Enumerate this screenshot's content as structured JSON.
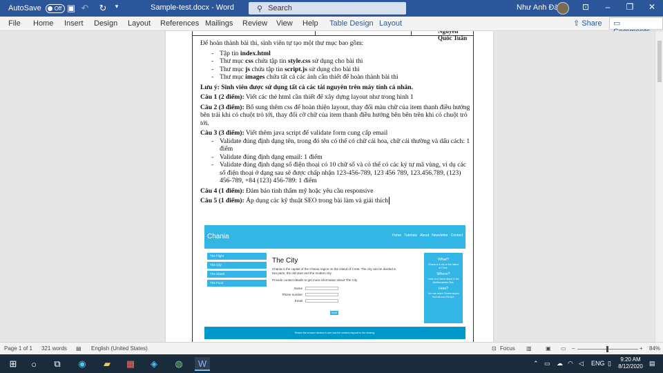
{
  "titlebar": {
    "autosave_label": "AutoSave",
    "autosave_state": "Off",
    "filename": "Sample-test.docx  -  Word",
    "search_placeholder": "Search",
    "user_name": "Như Anh Đào"
  },
  "ribbon": {
    "tabs": [
      "File",
      "Home",
      "Insert",
      "Design",
      "Layout",
      "References",
      "Mailings",
      "Review",
      "View",
      "Help",
      "Table Design",
      "Layout"
    ],
    "share_label": "Share",
    "comments_label": "Comments"
  },
  "document": {
    "header_name": "Nguyễn Quốc Tuấn",
    "intro": "Để hoàn thành bài thi, sinh viên tự tạo một thư mục bao gồm:",
    "files": [
      {
        "pre": "Tập tin ",
        "bold": "index.html",
        "post": ""
      },
      {
        "pre": "Thư mục ",
        "bold": "css",
        "post": " chứa tập tin ",
        "bold2": "style.css",
        "post2": " sử dụng cho bài thi"
      },
      {
        "pre": "Thư mục ",
        "bold": "js",
        "post": " chứa tập tin ",
        "bold2": "script.js",
        "post2": " sử dụng cho bài thi"
      },
      {
        "pre": "Thư mục ",
        "bold": "images",
        "post": " chứa tất cả các ảnh cần thiết để hoàn thành bài thi"
      }
    ],
    "note_label": "Lưu ý:",
    "note_text": " Sinh viên được sử dụng tất cả các tài nguyên trên máy tính cá nhân.",
    "q1_label": "Câu 1 (2 điểm):",
    "q1_text": " Viết các thẻ html cần thiết để xây dựng layout như trong hình 1",
    "q2_label": "Câu 2 (3 điểm):",
    "q2_text": " Bổ sung thêm css để hoàn thiện layout, thay đổi màu chữ của item thanh điều hướng bên trái khi có chuột trỏ tới, thay đổi cỡ chữ của item thanh điều hướng bên bên trên khi có chuột trỏ tới.",
    "q3_label": "Câu 3 (3 điểm):",
    "q3_text": " Viết thêm java script để validate form cung cấp email",
    "q3_items": [
      "Validate đúng định dạng tên, trong đó tên có thể có chữ cái hoa, chữ cái thường và dấu cách: 1 điểm",
      "Validate đúng định dạng email: 1 điểm",
      "Validate đúng định dạng số điện thoại có 10 chữ số và có thể có các ký tự mã vùng, ví dụ các số điện thoại ở dạng sau sẽ được chấp nhận 123-456-789, 123 456 789, 123.456.789, (123) 456-789, +84 (123) 456-789: 1 điểm"
    ],
    "q4_label": "Câu 4 (1 điểm):",
    "q4_text": " Đảm bảo tính thẩm mỹ hoặc yêu cầu responsive",
    "q5_label": "Câu 5 (1 điểm):",
    "q5_text": " Áp dụng các kỹ thuật SEO trong bài làm và giải thích"
  },
  "mockup": {
    "logo": "Chania",
    "nav": [
      "Home",
      "Tutorials",
      "About",
      "Newsletter",
      "Contact"
    ],
    "menu": [
      "The Flight",
      "The City",
      "The Island",
      "The Food"
    ],
    "heading": "The City",
    "paragraph": "Chania is the capital of the Chania region on the island of Crete. The city can be divided in two parts, the old town and the modern city.",
    "form_intro": "Provide contact details to get more information about The City",
    "form_labels": [
      "Name",
      "Phone number",
      "Email"
    ],
    "submit": "Send",
    "aside": [
      {
        "title": "What?",
        "text": "Chania is a city on the island of Crete."
      },
      {
        "title": "Where?",
        "text": "Crete is a Greek island in the Mediterranean Sea."
      },
      {
        "title": "How?",
        "text": "You can reach Chania airport from all over Europe."
      }
    ],
    "footer": "Resize the browser window to see how the content respond to the resizing."
  },
  "statusbar": {
    "page": "Page 1 of 1",
    "words": "321 words",
    "language": "English (United States)",
    "focus": "Focus",
    "zoom": "84%"
  },
  "taskbar": {
    "lang": "ENG",
    "time": "9:20 AM",
    "date": "8/12/2020"
  }
}
